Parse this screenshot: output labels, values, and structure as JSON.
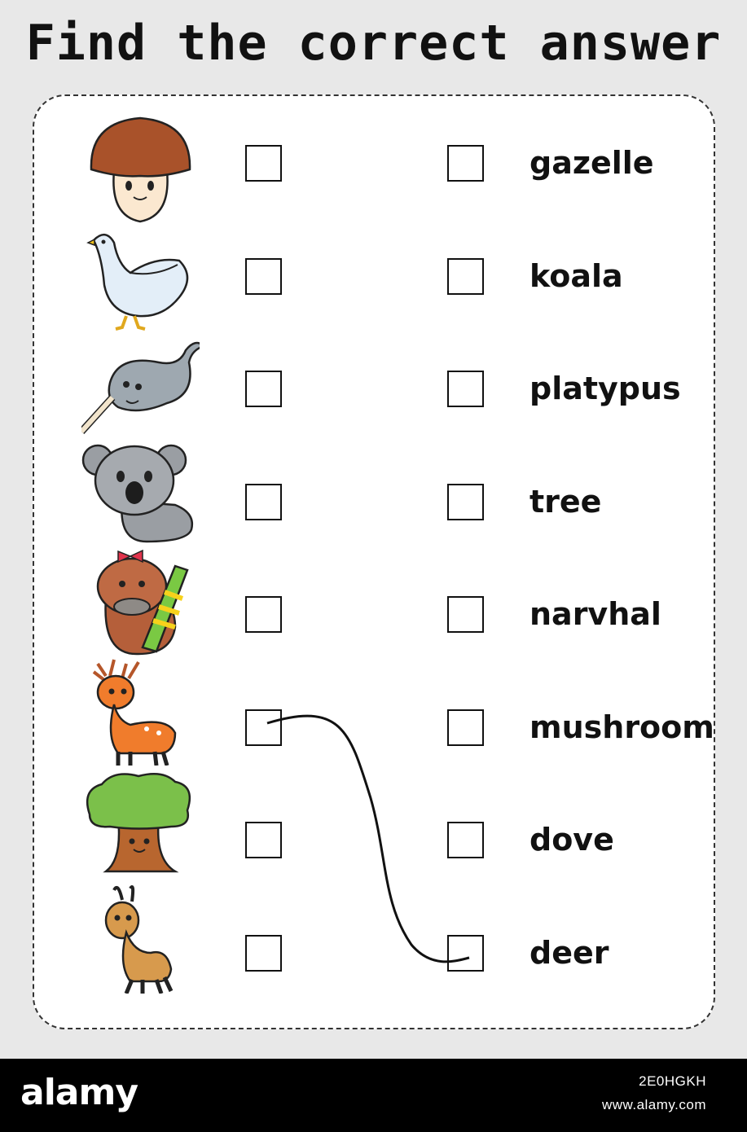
{
  "title": "Find the correct answer",
  "pictures": [
    {
      "name": "mushroom-icon"
    },
    {
      "name": "dove-icon"
    },
    {
      "name": "narwhal-icon"
    },
    {
      "name": "koala-icon"
    },
    {
      "name": "platypus-icon"
    },
    {
      "name": "deer-icon"
    },
    {
      "name": "tree-icon"
    },
    {
      "name": "gazelle-icon"
    }
  ],
  "words": [
    "gazelle",
    "koala",
    "platypus",
    "tree",
    "narvhal",
    "mushroom",
    "dove",
    "deer"
  ],
  "example_match": {
    "picture": "deer",
    "word": "deer"
  },
  "footer": {
    "logo": "alamy",
    "image_id": "2E0HGKH",
    "url": "www.alamy.com"
  }
}
